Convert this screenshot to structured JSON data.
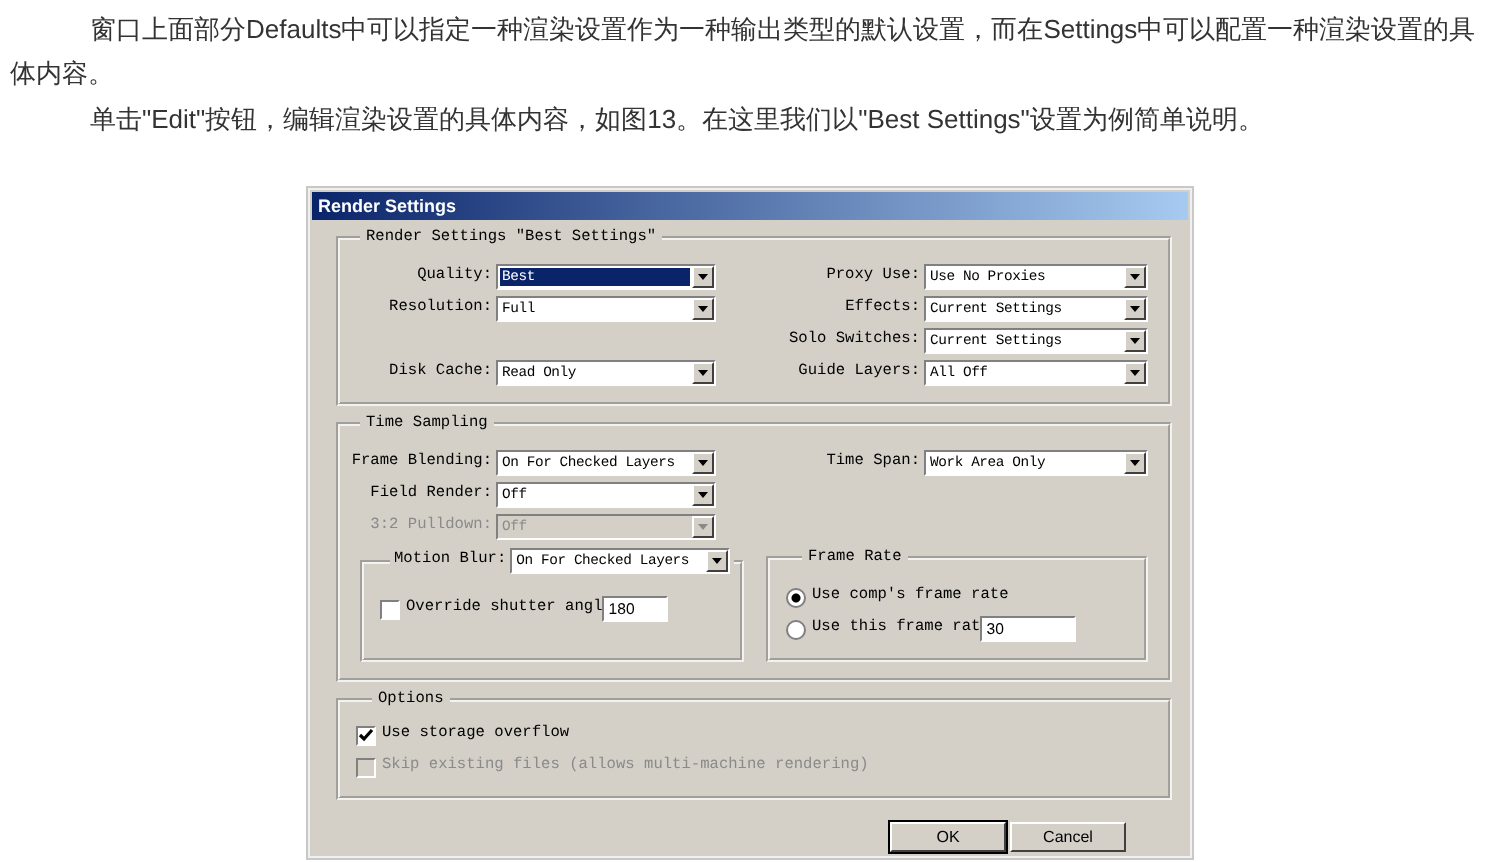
{
  "article": {
    "paragraphs": [
      "窗口上面部分Defaults中可以指定一种渲染设置作为一种输出类型的默认设置，而在Settings中可以配置一种渲染设置的具体内容。",
      "单击\"Edit\"按钮，编辑渲染设置的具体内容，如图13。在这里我们以\"Best Settings\"设置为例简单说明。"
    ]
  },
  "dialog": {
    "title": "Render Settings",
    "render_group": {
      "legend": "Render Settings \"Best Settings\"",
      "left": [
        {
          "label": "Quality:",
          "value": "Best",
          "focused": true,
          "disabled": false
        },
        {
          "label": "Resolution:",
          "value": "Full",
          "focused": false,
          "disabled": false
        },
        {
          "label": "Disk Cache:",
          "value": "Read Only",
          "focused": false,
          "disabled": false
        }
      ],
      "right": [
        {
          "label": "Proxy Use:",
          "value": "Use No Proxies",
          "focused": false,
          "disabled": false
        },
        {
          "label": "Effects:",
          "value": "Current Settings",
          "focused": false,
          "disabled": false
        },
        {
          "label": "Solo Switches:",
          "value": "Current Settings",
          "focused": false,
          "disabled": false
        },
        {
          "label": "Guide Layers:",
          "value": "All Off",
          "focused": false,
          "disabled": false
        }
      ]
    },
    "time_sampling": {
      "legend": "Time Sampling",
      "left": [
        {
          "label": "Frame Blending:",
          "value": "On For Checked Layers",
          "focused": false,
          "disabled": false
        },
        {
          "label": "Field Render:",
          "value": "Off",
          "focused": false,
          "disabled": false
        },
        {
          "label": "3:2 Pulldown:",
          "value": "Off",
          "focused": false,
          "disabled": true
        }
      ],
      "right": [
        {
          "label": "Time Span:",
          "value": "Work Area Only",
          "focused": false,
          "disabled": false
        }
      ],
      "motion_blur": {
        "dropdown": {
          "label": "Motion Blur:",
          "value": "On For Checked Layers",
          "focused": false,
          "disabled": false
        },
        "checkbox": {
          "label": "Override shutter angl",
          "checked": false,
          "value": "180"
        }
      },
      "frame_rate": {
        "legend": "Frame Rate",
        "options": [
          {
            "label": "Use comp's frame rate",
            "selected": true
          },
          {
            "label": "Use this frame rat",
            "selected": false,
            "value": "30"
          }
        ]
      }
    },
    "options": {
      "legend": "Options",
      "checkboxes": [
        {
          "label": "Use storage overflow",
          "checked": true,
          "disabled": false
        },
        {
          "label": "Skip existing files (allows multi-machine rendering)",
          "checked": false,
          "disabled": true
        }
      ]
    },
    "buttons": [
      {
        "label": "OK",
        "default": true
      },
      {
        "label": "Cancel",
        "default": false
      }
    ]
  }
}
